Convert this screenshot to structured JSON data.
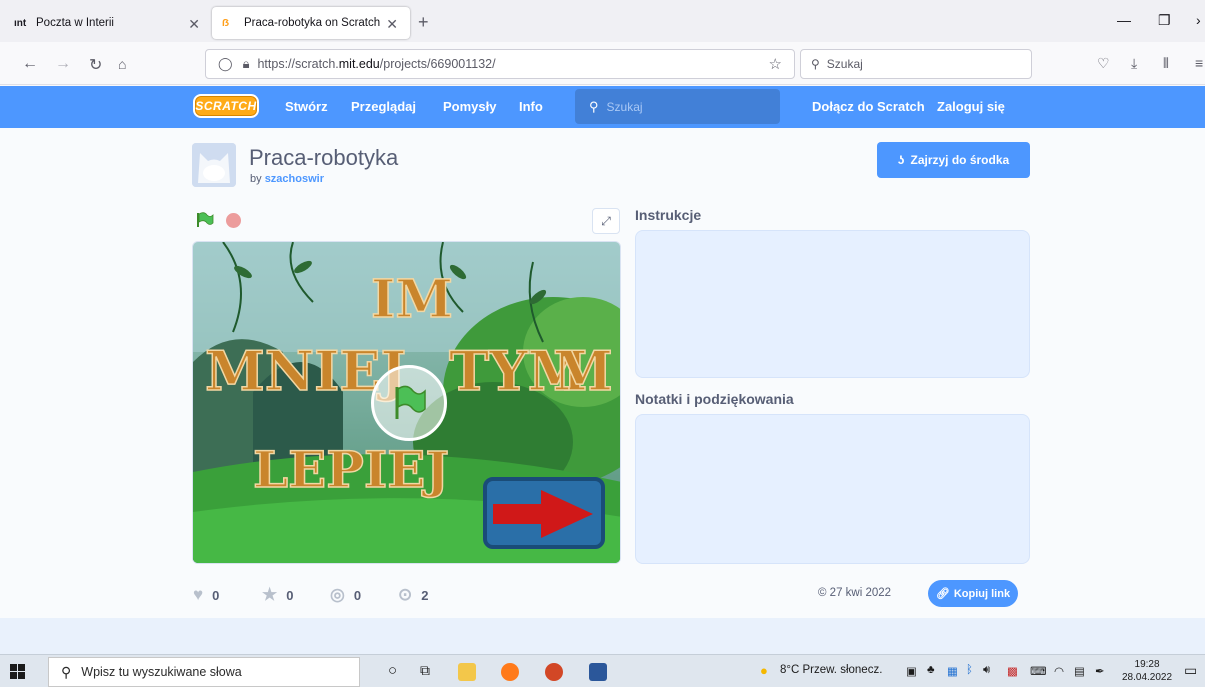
{
  "browser": {
    "tabs": [
      {
        "favicon_text": "ınt",
        "title": "Poczta w Interii",
        "active": false
      },
      {
        "favicon_text": "ẞ",
        "title": "Praca-robotyka on Scratch",
        "active": true
      }
    ],
    "url_prefix": "https://scratch.",
    "url_domain": "mit.edu",
    "url_path": "/projects/669001132/",
    "search_placeholder": "Szukaj"
  },
  "scratch_nav": {
    "logo": "SCRATCH",
    "links": [
      "Stwórz",
      "Przeglądaj",
      "Pomysły",
      "Info"
    ],
    "search_placeholder": "Szukaj",
    "join": "Dołącz do Scratch",
    "signin": "Zaloguj się"
  },
  "project": {
    "title": "Praca-robotyka",
    "by_label": "by",
    "author": "szachoswir",
    "see_inside": "Zajrzyj do środka",
    "instructions_label": "Instrukcje",
    "notes_label": "Notatki i podziękowania",
    "stage_text": {
      "line1": "IM",
      "line2a": "MNIEJ",
      "line2b": "TYM",
      "line2c": "M",
      "line3": "LEPIEJ"
    },
    "stats": {
      "loves": "0",
      "favorites": "0",
      "remixes": "0",
      "views": "2"
    },
    "date": "© 27 kwi 2022",
    "copy_link": "Kopiuj link"
  },
  "taskbar": {
    "search_placeholder": "Wpisz tu wyszukiwane słowa",
    "weather": "8°C  Przew. słonecz.",
    "time": "19:28",
    "date": "28.04.2022"
  },
  "colors": {
    "scratch_blue": "#4d97ff",
    "scratch_orange": "#ffab19",
    "text": "#575e75"
  }
}
